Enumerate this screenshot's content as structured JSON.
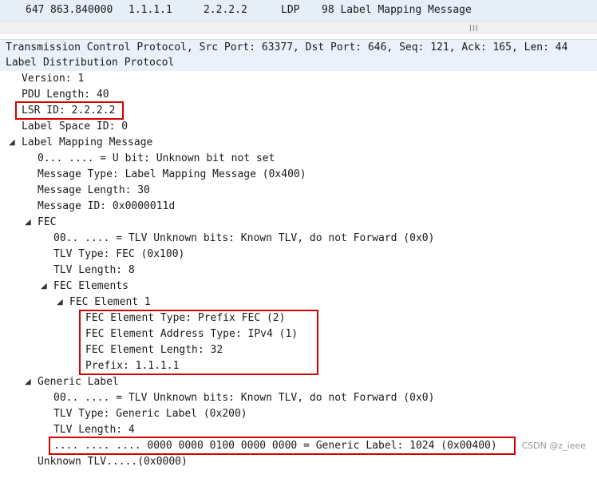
{
  "packet_list": {
    "no": "647",
    "time": "863.840000",
    "source": "1.1.1.1",
    "destination": "2.2.2.2",
    "protocol": "LDP",
    "info": "98 Label Mapping Message"
  },
  "scroll_grip": "|||",
  "tree": [
    {
      "text": "Transmission Control Protocol, Src Port: 63377, Dst Port: 646, Seq: 121, Ack: 165, Len: 44",
      "arrow": ""
    },
    {
      "text": "Label Distribution Protocol",
      "arrow": ""
    },
    {
      "text": "Version: 1",
      "arrow": ""
    },
    {
      "text": "PDU Length: 40",
      "arrow": ""
    },
    {
      "text": "LSR ID: 2.2.2.2",
      "arrow": ""
    },
    {
      "text": "Label Space ID: 0",
      "arrow": ""
    },
    {
      "text": "Label Mapping Message",
      "arrow": "◢"
    },
    {
      "text": "0... .... = U bit: Unknown bit not set",
      "arrow": ""
    },
    {
      "text": "Message Type: Label Mapping Message (0x400)",
      "arrow": ""
    },
    {
      "text": "Message Length: 30",
      "arrow": ""
    },
    {
      "text": "Message ID: 0x0000011d",
      "arrow": ""
    },
    {
      "text": "FEC",
      "arrow": "◢"
    },
    {
      "text": "00.. .... = TLV Unknown bits: Known TLV, do not Forward (0x0)",
      "arrow": ""
    },
    {
      "text": "TLV Type: FEC (0x100)",
      "arrow": ""
    },
    {
      "text": "TLV Length: 8",
      "arrow": ""
    },
    {
      "text": "FEC Elements",
      "arrow": "◢"
    },
    {
      "text": "FEC Element 1",
      "arrow": "◢"
    },
    {
      "text": "FEC Element Type: Prefix FEC (2)",
      "arrow": ""
    },
    {
      "text": "FEC Element Address Type: IPv4 (1)",
      "arrow": ""
    },
    {
      "text": "FEC Element Length: 32",
      "arrow": ""
    },
    {
      "text": "Prefix: 1.1.1.1",
      "arrow": ""
    },
    {
      "text": "Generic Label",
      "arrow": "◢"
    },
    {
      "text": "00.. .... = TLV Unknown bits: Known TLV, do not Forward (0x0)",
      "arrow": ""
    },
    {
      "text": "TLV Type: Generic Label (0x200)",
      "arrow": ""
    },
    {
      "text": "TLV Length: 4",
      "arrow": ""
    },
    {
      "text": ".... .... .... 0000 0000 0100 0000 0000 = Generic Label: 1024 (0x00400)",
      "arrow": ""
    },
    {
      "text": "Unknown TLV.....(0x0000)",
      "arrow": ""
    }
  ],
  "watermark": "CSDN @z_ieee"
}
